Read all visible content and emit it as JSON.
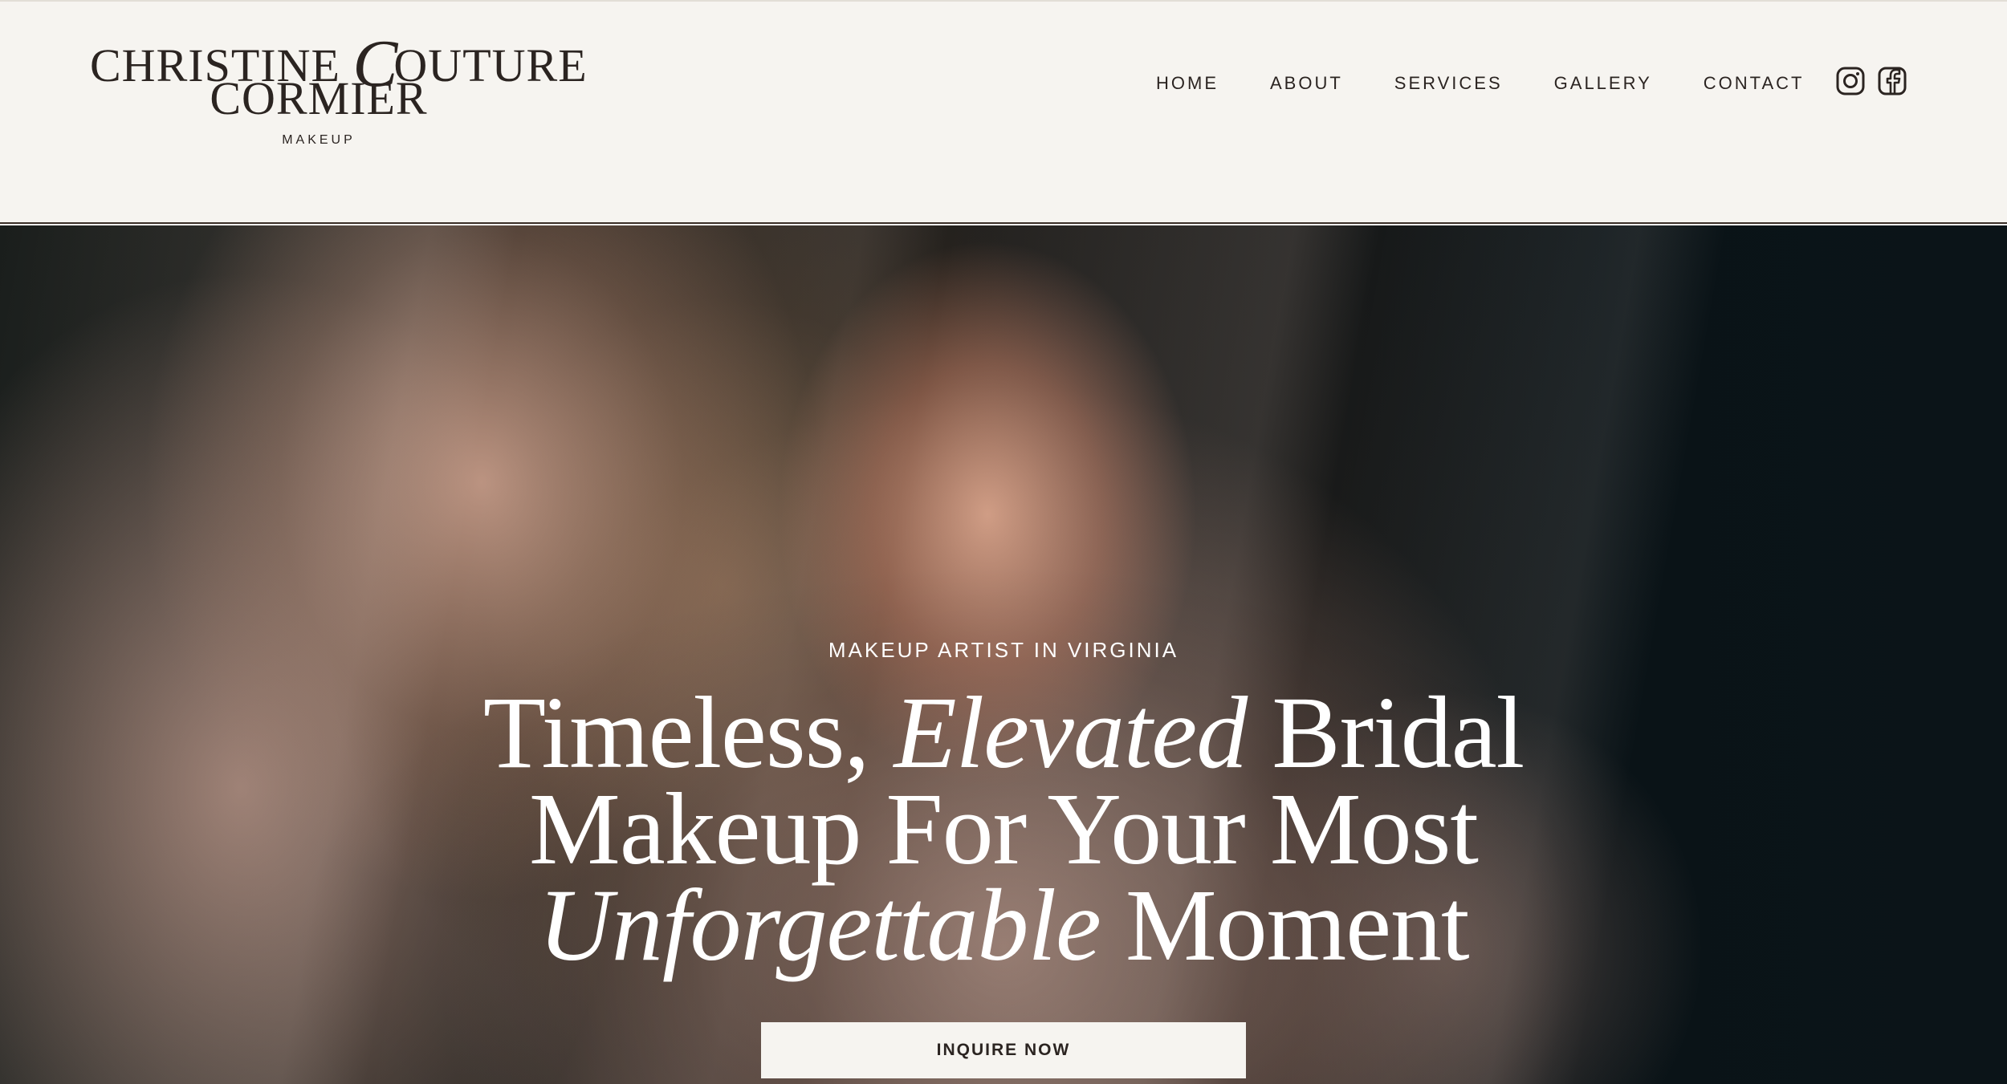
{
  "header": {
    "logo": {
      "line1_part1": "CHRISTINE",
      "line1_script": "C",
      "line1_part2": "OUTURE",
      "line2": "CORMIER",
      "sub": "MAKEUP"
    },
    "nav": [
      {
        "label": "HOME"
      },
      {
        "label": "ABOUT"
      },
      {
        "label": "SERVICES"
      },
      {
        "label": "GALLERY"
      },
      {
        "label": "CONTACT"
      }
    ],
    "social": [
      {
        "icon": "instagram-icon"
      },
      {
        "icon": "facebook-icon"
      }
    ]
  },
  "hero": {
    "eyebrow": "MAKEUP ARTIST IN VIRGINIA",
    "title": {
      "line1_a": "Timeless, ",
      "line1_em": "Elevated",
      "line1_b": " Bridal",
      "line2": "Makeup For Your Most",
      "line3_em": "Unforgettable",
      "line3_b": " Moment"
    },
    "cta_label": "INQUIRE NOW"
  },
  "colors": {
    "header_bg": "#f6f4f0",
    "text_dark": "#2b2421",
    "hero_text": "#ffffff",
    "cta_bg": "#f6f4f0"
  }
}
